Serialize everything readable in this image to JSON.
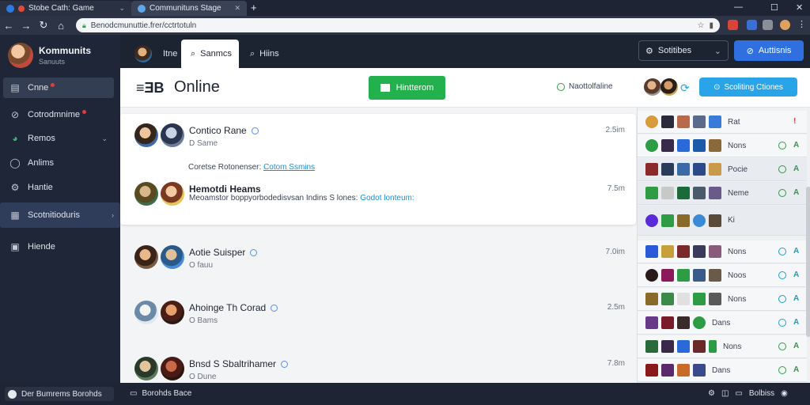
{
  "browser": {
    "tabs": [
      {
        "label": "Stobe Cath: Game"
      },
      {
        "label": "Communituns Stage"
      }
    ],
    "new_tab": "+",
    "url": "Benodcmunuttie.frer/cctrtotuln"
  },
  "sidebar": {
    "profile_name": "Kommunits",
    "profile_sub": "Sanuuts",
    "items": [
      {
        "label": "Cnne",
        "icon": "document-icon"
      },
      {
        "label": "Cotrodmnime",
        "icon": "compass-icon"
      },
      {
        "label": "Remos",
        "icon": "globe-icon"
      },
      {
        "label": "Anlims",
        "icon": "circle-icon"
      },
      {
        "label": "Hantie",
        "icon": "settings-icon"
      },
      {
        "label": "Scotnitioduris",
        "icon": "grid-icon"
      },
      {
        "label": "Hiende",
        "icon": "box-icon"
      }
    ]
  },
  "topbar": {
    "tabs": [
      {
        "label": "Itne"
      },
      {
        "label": "Sanmcs"
      },
      {
        "label": "Hiins"
      }
    ],
    "select_label": "Sotitibes",
    "primary_button": "Auttisnis"
  },
  "header": {
    "title": "Online",
    "green_button": "Hintterom",
    "status_text": "Naottolfaline",
    "sky_button": "Scoliting Ctiones"
  },
  "feed": {
    "posts": [
      {
        "name": "Contico Rane",
        "sub": "D Same",
        "time": "2.5im"
      },
      {
        "text": "Coretse Rotonenser:",
        "link": "Cotom Ssmins"
      },
      {
        "name": "Hemotdi Heams",
        "text": "Meoamstor boppyorbodedisvsan Indins S lones:",
        "link": "Godot lonteum:",
        "time": "7.5m"
      },
      {
        "name": "Aotie Suisper",
        "sub": "O fauu",
        "time": "7.0im"
      },
      {
        "name": "Ahoinge Th Corad",
        "sub": "O Bams",
        "time": "2.5m"
      },
      {
        "name": "Bnsd S Sbaltrihamer",
        "sub": "O Dune",
        "time": "7.8m"
      }
    ]
  },
  "right_list": [
    {
      "label": "Rat",
      "status": "!"
    },
    {
      "label": "Nons",
      "status": "A"
    },
    {
      "label": "Pocie",
      "status": "A"
    },
    {
      "label": "Neme",
      "status": "A"
    },
    {
      "label": "Ki",
      "status": ""
    },
    {
      "label": "Nons",
      "status": "A"
    },
    {
      "label": "Noos",
      "status": "A"
    },
    {
      "label": "Nons",
      "status": "A"
    },
    {
      "label": "Dans",
      "status": "A"
    },
    {
      "label": "Nons",
      "status": "A"
    },
    {
      "label": "Dans",
      "status": "A"
    }
  ],
  "statusbar": {
    "search": "Der Bumrems Borohds",
    "mid": "Borohds Bace",
    "right": "Bolbiss"
  }
}
